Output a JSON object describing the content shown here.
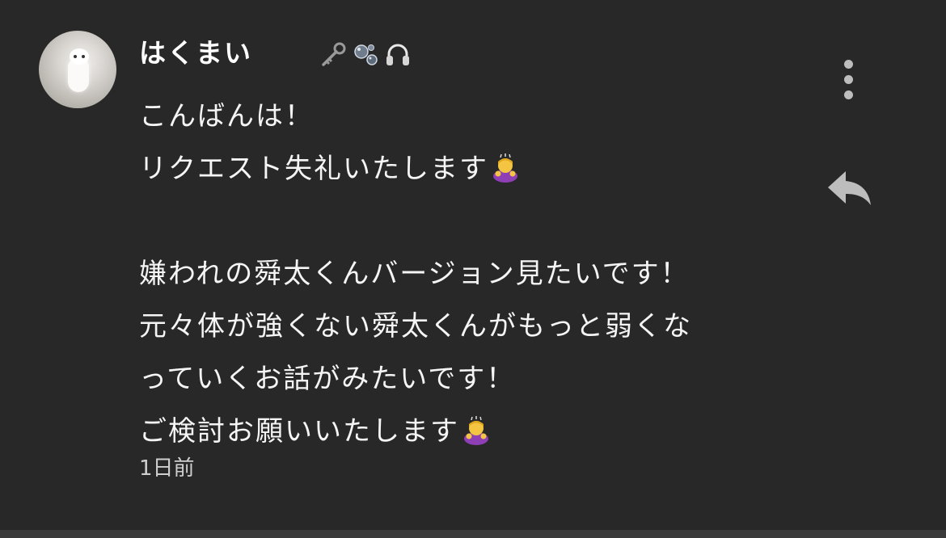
{
  "comment": {
    "author": {
      "name": "はくまい",
      "avatar_icon": "cat-avatar-icon",
      "name_emojis": [
        "key-icon",
        "bubbles-icon",
        "headphones-icon"
      ]
    },
    "lines": [
      "こんばんは！",
      "リクエスト失礼いたします",
      "",
      "嫌われの舜太くんバージョン見たいです！",
      "元々体が強くない舜太くんがもっと弱くな",
      "っていくお話がみたいです！",
      "ご検討お願いいたします"
    ],
    "inline_emoji": "person-bowing-icon",
    "timestamp": "1日前"
  },
  "actions": {
    "menu_icon": "more-vert-icon",
    "reply_icon": "reply-icon"
  },
  "colors": {
    "background": "#282828",
    "text": "#f5f5f5",
    "secondary_text": "#cfcfcf",
    "icon": "#bdbdbd"
  }
}
